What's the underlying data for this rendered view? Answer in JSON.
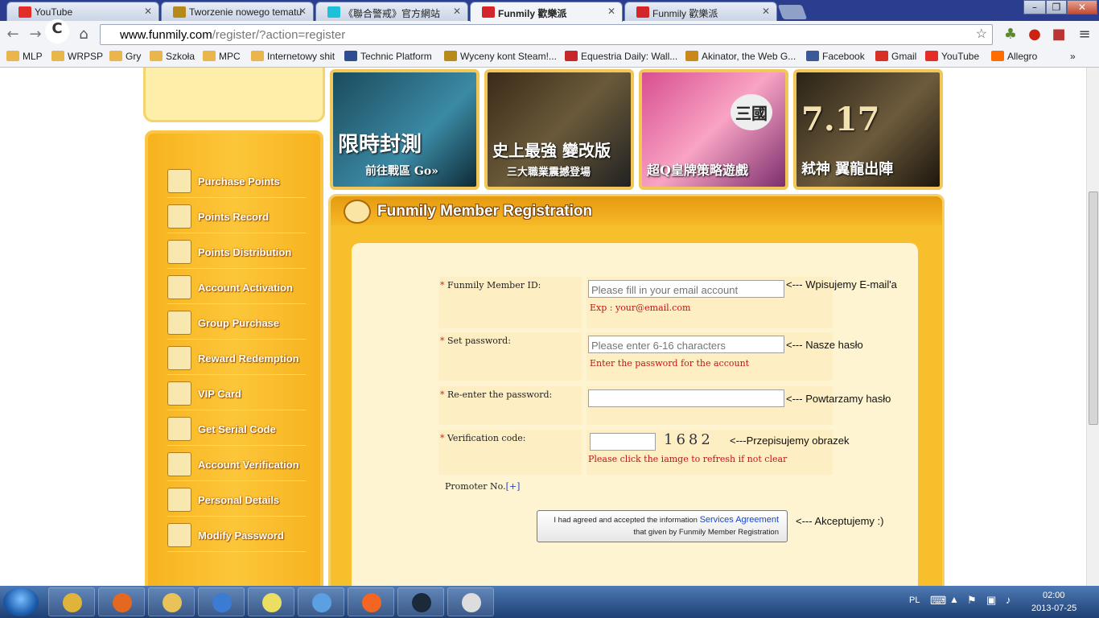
{
  "browser": {
    "tabs": [
      {
        "title": "YouTube",
        "color": "#e52d27",
        "active": false
      },
      {
        "title": "Tworzenie nowego tematu",
        "color": "#b58a1b",
        "active": false
      },
      {
        "title": "《聯合警戒》官方網站",
        "color": "#1dc0d8",
        "active": false
      },
      {
        "title": "Funmily 歡樂派",
        "color": "#d4252a",
        "active": true
      },
      {
        "title": "Funmily 歡樂派",
        "color": "#d4252a",
        "active": false
      }
    ],
    "window_buttons": [
      "–",
      "❐",
      "✕"
    ],
    "url_domain": "www.funmily.com",
    "url_path": "/register/?action=register",
    "bookmarks": [
      {
        "label": "MLP",
        "icon": "folder-icon"
      },
      {
        "label": "WRPSP",
        "icon": "folder-icon"
      },
      {
        "label": "Gry",
        "icon": "folder-icon"
      },
      {
        "label": "Szkoła",
        "icon": "folder-icon"
      },
      {
        "label": "MPC",
        "icon": "folder-icon"
      },
      {
        "label": "Internetowy shit",
        "icon": "folder-icon"
      },
      {
        "label": "Technic Platform",
        "icon": "technic-icon"
      },
      {
        "label": "Wyceny kont Steam!...",
        "icon": "steam-icon"
      },
      {
        "label": "Equestria Daily: Wall...",
        "icon": "eqd-icon"
      },
      {
        "label": "Akinator, the Web G...",
        "icon": "akinator-icon"
      },
      {
        "label": "Facebook",
        "icon": "facebook-icon"
      },
      {
        "label": "Gmail",
        "icon": "gmail-icon"
      },
      {
        "label": "YouTube",
        "icon": "youtube-icon"
      },
      {
        "label": "Allegro",
        "icon": "allegro-icon"
      }
    ],
    "more_bookmarks": "»"
  },
  "sidebar": {
    "items": [
      {
        "label": "Purchase Points",
        "icon": "purchase-points-icon"
      },
      {
        "label": "Points Record",
        "icon": "points-record-icon"
      },
      {
        "label": "Points Distribution",
        "icon": "points-distribution-icon"
      },
      {
        "label": "Account Activation",
        "icon": "account-activation-icon"
      },
      {
        "label": "Group Purchase",
        "icon": "group-purchase-icon"
      },
      {
        "label": "Reward Redemption",
        "icon": "reward-redemption-icon"
      },
      {
        "label": "VIP Card",
        "icon": "vip-card-icon"
      },
      {
        "label": "Get Serial Code",
        "icon": "serial-code-icon"
      },
      {
        "label": "Account Verification",
        "icon": "account-verification-icon"
      },
      {
        "label": "Personal Details",
        "icon": "personal-details-icon"
      },
      {
        "label": "Modify Password",
        "icon": "modify-password-icon"
      }
    ]
  },
  "banners": [
    {
      "caption": "限時封測",
      "sub": "前往戰區 Go»"
    },
    {
      "caption": "史上最強 變改版",
      "sub": "三大職業震撼登場"
    },
    {
      "caption": "超Q皇牌策略遊戲",
      "sub": "三國"
    },
    {
      "caption": "7.17",
      "sub": "弒神 翼龍出陣"
    }
  ],
  "registration": {
    "title": "Funmily Member Registration",
    "fields": [
      {
        "label": "Funmily Member ID:",
        "placeholder": "Please fill in your email account",
        "hint": "Exp : your@email.com",
        "note": "<--- Wpisujemy E-mail'a"
      },
      {
        "label": "Set password:",
        "placeholder": "Please enter 6-16 characters",
        "hint": "Enter the password for the account",
        "note": "<--- Nasze hasło"
      },
      {
        "label": "Re-enter the password:",
        "placeholder": "",
        "hint": "",
        "note": "<--- Powtarzamy hasło"
      },
      {
        "label": "Verification code:",
        "placeholder": "",
        "hint": "Please click the iamge to refresh if not clear",
        "note": "<---Przepisujemy obrazek"
      }
    ],
    "required_mark": "*",
    "captcha": "1682",
    "promoter_label": "Promoter No.",
    "promoter_link": "[+]",
    "agree_line1": "I had agreed and accepted the information",
    "agree_link": "Services Agreement",
    "agree_line2": "that given by Funmily Member Registration",
    "agree_note": "<--- Akceptujemy :)"
  },
  "taskbar": {
    "language": "PL",
    "time": "02:00",
    "date": "2013-07-25",
    "apps": [
      "chrome-icon",
      "firefox-icon",
      "explorer-icon",
      "media-player-icon",
      "sticky-notes-icon",
      "control-panel-icon",
      "origin-icon",
      "game-icon",
      "lemur-icon"
    ]
  }
}
